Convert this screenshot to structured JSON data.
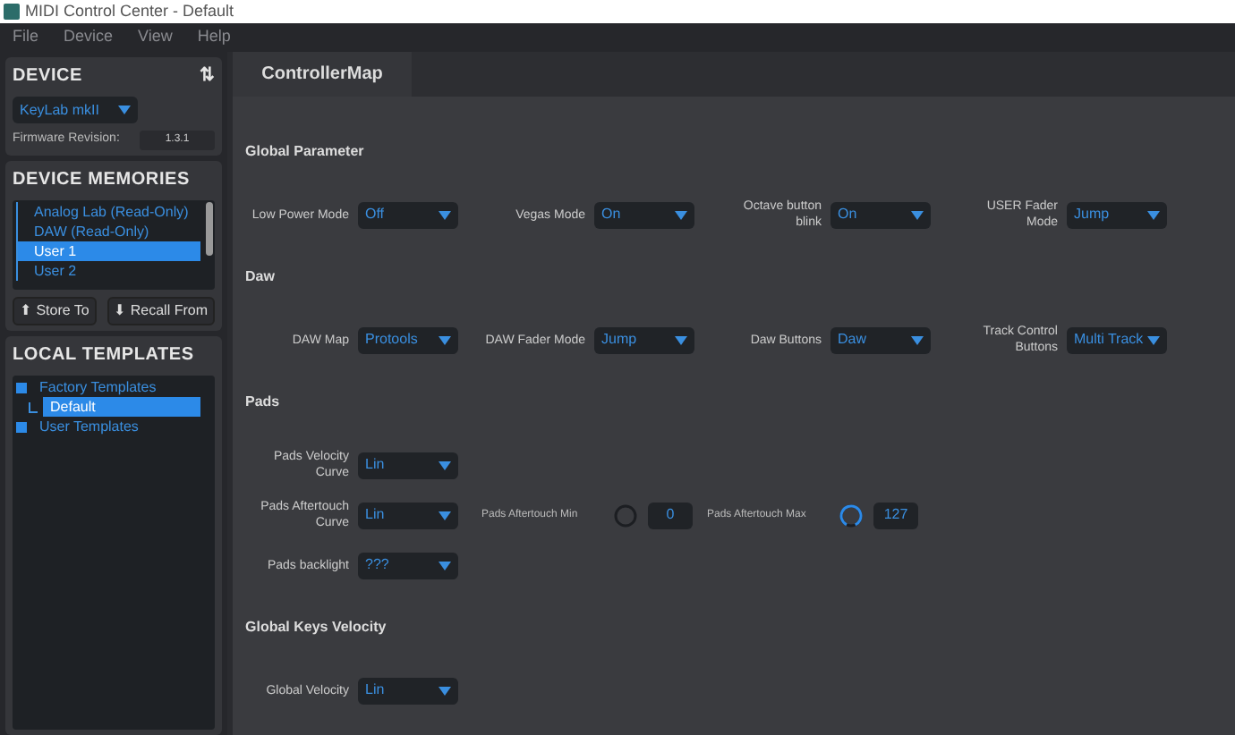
{
  "window": {
    "title": "MIDI Control Center - Default"
  },
  "menu": [
    "File",
    "Device",
    "View",
    "Help"
  ],
  "device": {
    "heading": "DEVICE",
    "sort_icon": "⇅",
    "model": "KeyLab mkII",
    "firmware_label": "Firmware Revision:",
    "firmware": "1.3.1"
  },
  "device_memories": {
    "heading": "DEVICE MEMORIES",
    "items": [
      {
        "label": "Analog Lab (Read-Only)",
        "selected": false
      },
      {
        "label": "DAW (Read-Only)",
        "selected": false
      },
      {
        "label": "User 1",
        "selected": true
      },
      {
        "label": "User 2",
        "selected": false
      }
    ],
    "buttons": [
      {
        "label": "Store To",
        "arrow": "⬆"
      },
      {
        "label": "Recall From",
        "arrow": "⬇"
      }
    ]
  },
  "local_templates": {
    "heading": "LOCAL TEMPLATES",
    "items": [
      {
        "label": "Factory Templates",
        "selected": false,
        "expanded": true,
        "children": [
          {
            "label": "Default",
            "selected": true
          }
        ]
      },
      {
        "label": "User Templates",
        "selected": false,
        "expanded": true
      }
    ]
  },
  "tabs": [
    {
      "label": "ControllerMap",
      "selected": true
    }
  ],
  "sections": [
    {
      "title": "Global Parameter",
      "rows": [
        [
          {
            "kind": "select",
            "label": "Low Power Mode",
            "value": "Off"
          },
          {
            "kind": "select",
            "label": "Vegas Mode",
            "value": "On"
          },
          {
            "kind": "select",
            "label": "Octave button blink",
            "value": "On"
          },
          {
            "kind": "select",
            "label": "USER Fader Mode",
            "value": "Jump"
          }
        ]
      ]
    },
    {
      "title": "Daw",
      "rows": [
        [
          {
            "kind": "select",
            "label": "DAW Map",
            "value": "Protools"
          },
          {
            "kind": "select",
            "label": "DAW Fader Mode",
            "value": "Jump"
          },
          {
            "kind": "select",
            "label": "Daw Buttons",
            "value": "Daw"
          },
          {
            "kind": "select",
            "label": "Track Control Buttons",
            "value": "Multi Track"
          }
        ]
      ]
    },
    {
      "title": "Pads",
      "rows": [
        [
          {
            "kind": "select",
            "label": "Pads Velocity Curve",
            "value": "Lin"
          }
        ],
        [
          {
            "kind": "select",
            "label": "Pads Aftertouch Curve",
            "value": "Lin"
          },
          {
            "kind": "knob",
            "label": "Pads Aftertouch Min",
            "value": "0"
          },
          {
            "kind": "knob",
            "label": "Pads Aftertouch Max",
            "value": "127"
          }
        ],
        [
          {
            "kind": "select",
            "label": "Pads backlight",
            "value": "???"
          }
        ]
      ]
    },
    {
      "title": "Global Keys Velocity",
      "rows": [
        [
          {
            "kind": "select",
            "label": "Global Velocity",
            "value": "Lin"
          }
        ]
      ]
    }
  ]
}
